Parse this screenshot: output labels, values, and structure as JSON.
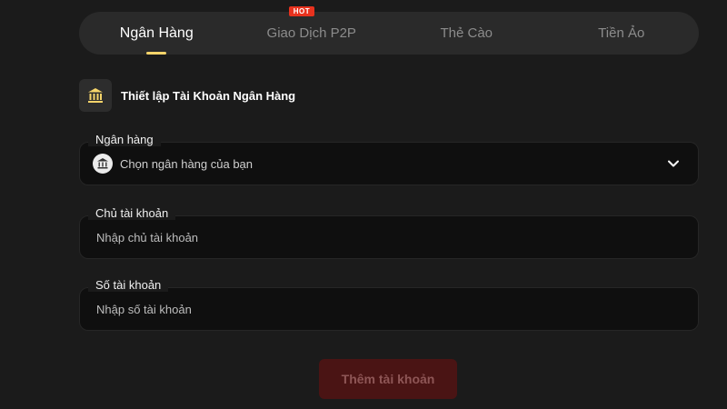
{
  "tabs": [
    {
      "label": "Ngân Hàng",
      "active": true
    },
    {
      "label": "Giao Dịch P2P",
      "badge": "HOT"
    },
    {
      "label": "Thẻ Cào"
    },
    {
      "label": "Tiền Ảo"
    }
  ],
  "section": {
    "icon": "bank-icon",
    "title": "Thiết lập Tài Khoản Ngân Hàng"
  },
  "fields": {
    "bank": {
      "label": "Ngân hàng",
      "placeholder": "Chọn ngân hàng của bạn",
      "icon": "bank-building-icon"
    },
    "holder": {
      "label": "Chủ tài khoản",
      "placeholder": "Nhập chủ tài khoản"
    },
    "number": {
      "label": "Số tài khoản",
      "placeholder": "Nhập số tài khoản"
    }
  },
  "submit": {
    "label": "Thêm tài khoản"
  },
  "colors": {
    "background": "#1b1b1b",
    "tab_underline": "#f5d46a",
    "hot_badge": "#e8321e",
    "submit_bg": "#4a1414"
  }
}
